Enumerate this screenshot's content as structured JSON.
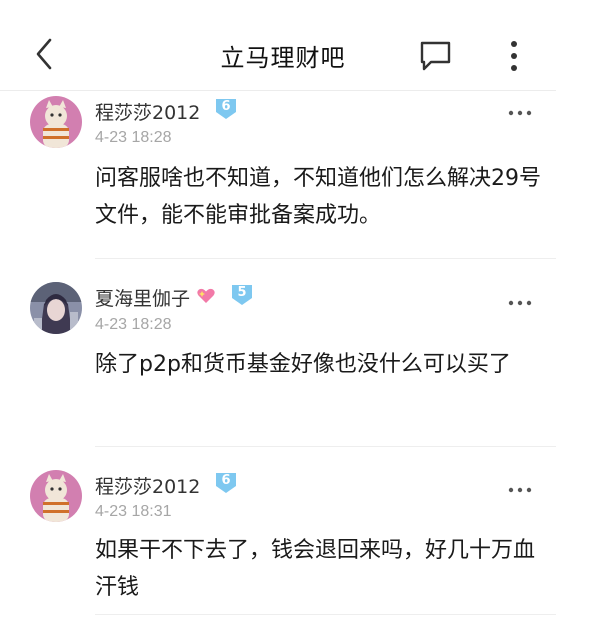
{
  "header": {
    "title": "立马理财吧",
    "back_icon": "chevron-left-icon",
    "comment_icon": "speech-bubble-icon",
    "more_icon": "vertical-ellipsis-icon"
  },
  "posts": [
    {
      "username": "程莎莎2012",
      "level": "6",
      "timestamp": "4-23 18:28",
      "body": "问客服啥也不知道，不知道他们怎么解决29号文件，能不能审批备案成功。"
    },
    {
      "username": "夏海里伽子",
      "level": "5",
      "timestamp": "4-23 18:28",
      "body": "除了p2p和货币基金好像也没什么可以买了",
      "name_emoji": "sparkle-heart-icon"
    },
    {
      "username": "程莎莎2012",
      "level": "6",
      "timestamp": "4-23 18:31",
      "body": "如果干不下去了，钱会退回来吗，好几十万血汗钱"
    }
  ],
  "colors": {
    "badge": "#7ec8f0",
    "timestamp": "#a6a6a6",
    "divider": "#eeeeee"
  }
}
